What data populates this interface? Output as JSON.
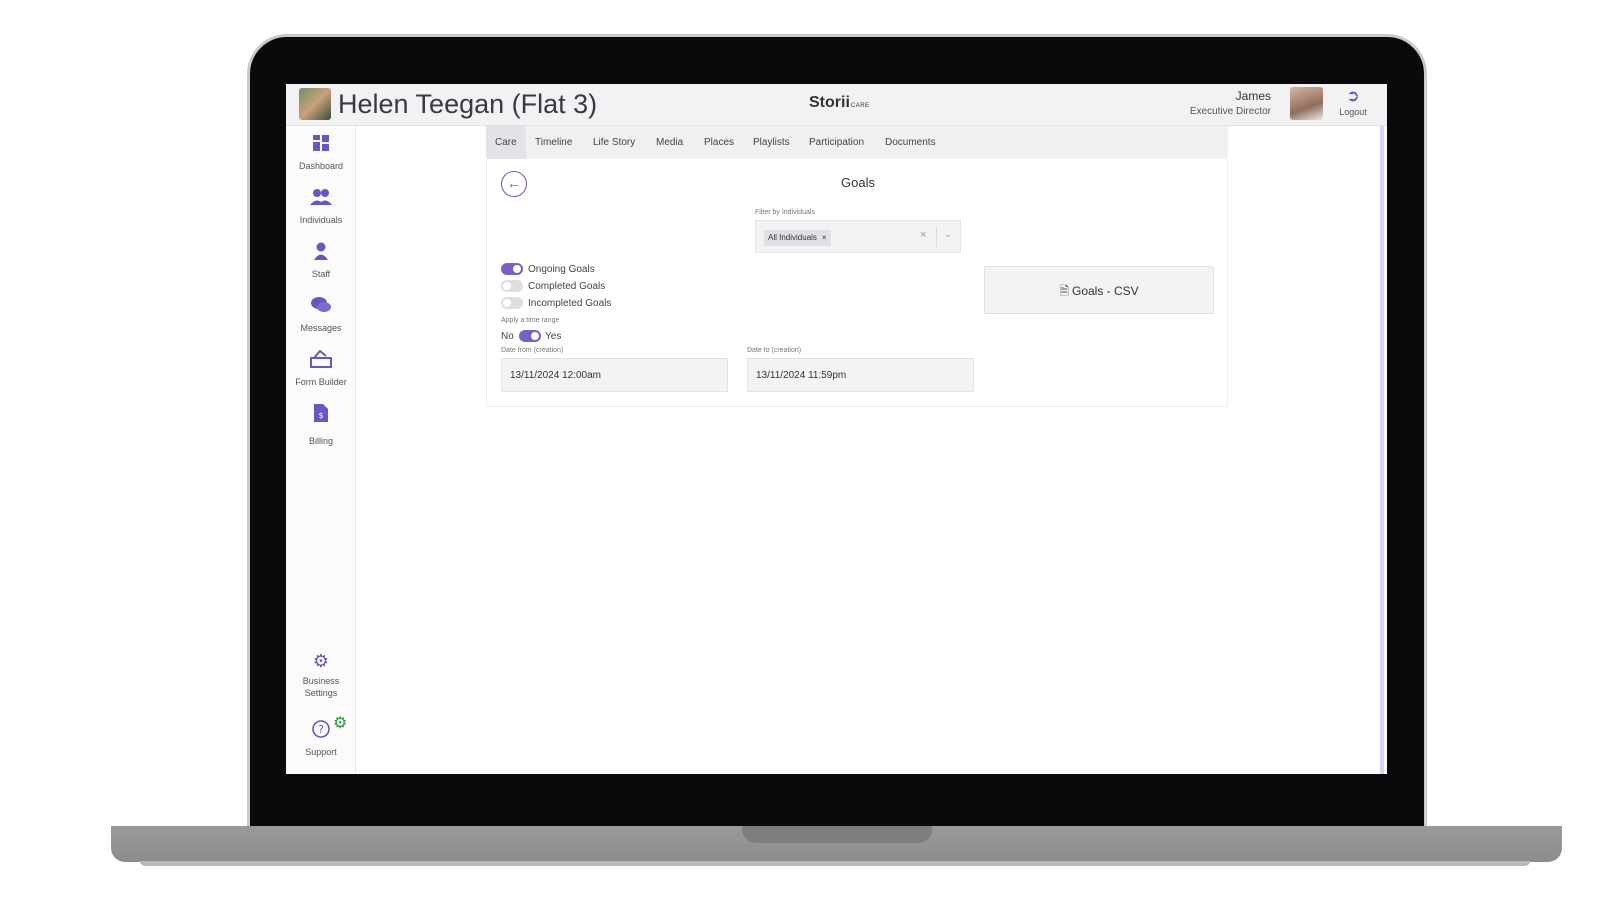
{
  "header": {
    "person_name": "Helen Teegan (Flat 3)",
    "brand": "Storii",
    "brand_sub": "CARE",
    "user_name": "James",
    "user_role": "Executive Director",
    "logout_label": "Logout"
  },
  "sidebar": {
    "items": [
      {
        "label": "Dashboard",
        "icon": "dashboard-icon"
      },
      {
        "label": "Individuals",
        "icon": "individuals-icon"
      },
      {
        "label": "Staff",
        "icon": "staff-icon"
      },
      {
        "label": "Messages",
        "icon": "messages-icon"
      },
      {
        "label": "Form Builder",
        "icon": "form-builder-icon"
      },
      {
        "label": "Billing",
        "icon": "billing-icon"
      }
    ],
    "bottom": [
      {
        "label": "Business Settings",
        "icon": "gear-icon"
      },
      {
        "label": "Support",
        "icon": "question-icon"
      }
    ]
  },
  "tabs": [
    "Care",
    "Timeline",
    "Life Story",
    "Media",
    "Places",
    "Playlists",
    "Participation",
    "Documents"
  ],
  "active_tab": "Care",
  "goals": {
    "title": "Goals",
    "filter_label": "Filter by Individuals",
    "filter_chip": "All Individuals",
    "toggles": [
      {
        "label": "Ongoing Goals",
        "on": true
      },
      {
        "label": "Completed Goals",
        "on": false
      },
      {
        "label": "Incompleted Goals",
        "on": false
      }
    ],
    "time_range_label": "Apply a time range",
    "time_range_no": "No",
    "time_range_yes": "Yes",
    "time_range_on": true,
    "date_from_label": "Date from (creation)",
    "date_from": "13/11/2024 12:00am",
    "date_to_label": "Date to (creation)",
    "date_to": "13/11/2024 11:59pm",
    "csv_button": "Goals - CSV"
  },
  "colors": {
    "accent": "#6b56c0",
    "toggle_on": "#7a60c4",
    "support_badge": "#1e9b3a"
  }
}
